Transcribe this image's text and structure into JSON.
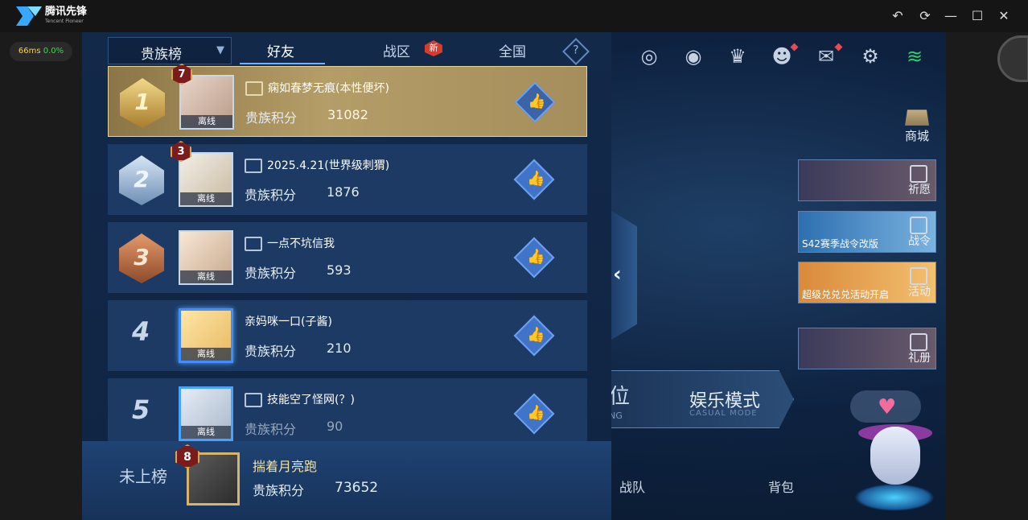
{
  "app": {
    "name": "腾讯先锋",
    "sub": "Tencent Pioneer"
  },
  "perf": {
    "ms": "66ms",
    "loss": "0.0%"
  },
  "window_controls": [
    "undo-icon",
    "refresh-icon",
    "minimize-icon",
    "maximize-icon",
    "close-icon"
  ],
  "tabs": {
    "dropdown": "贵族榜",
    "items": [
      {
        "label": "好友",
        "active": true
      },
      {
        "label": "战区",
        "badge": "新"
      },
      {
        "label": "全国"
      }
    ],
    "help": "?"
  },
  "rows": [
    {
      "rank": "1",
      "level": "7",
      "status": "离线",
      "name": "痫如春梦无痕(本性便坏)",
      "score_label": "贵族积分",
      "score": "31082"
    },
    {
      "rank": "2",
      "level": "3",
      "status": "离线",
      "name": "2025.4.21(世界级刺猬)",
      "score_label": "贵族积分",
      "score": "1876"
    },
    {
      "rank": "3",
      "status": "离线",
      "name": "一点不坑信我",
      "score_label": "贵族积分",
      "score": "593"
    },
    {
      "rank": "4",
      "status": "离线",
      "name": "亲妈咪一口(子酱)",
      "score_label": "贵族积分",
      "score": "210"
    },
    {
      "rank": "5",
      "status": "离线",
      "name": "技能空了怪网(？)",
      "score_label": "贵族积分",
      "score": "90"
    }
  ],
  "footer": {
    "unranked": "未上榜",
    "level": "8",
    "name": "揣着月亮跑",
    "score_label": "贵族积分",
    "score": "73652"
  },
  "game_ui": {
    "shop": "商城",
    "side_buttons": [
      {
        "label": "祈愿"
      },
      {
        "label": "战令",
        "caption": "S42赛季战令改版"
      },
      {
        "label": "活动",
        "caption": "超级兑兑兑活动开启"
      },
      {
        "label": "礼册"
      }
    ],
    "mode_a": "位",
    "mode_a_sub": "NG",
    "mode_b": "娱乐模式",
    "mode_b_sub": "CASUAL MODE",
    "bottom": [
      "战队",
      "背包"
    ]
  }
}
